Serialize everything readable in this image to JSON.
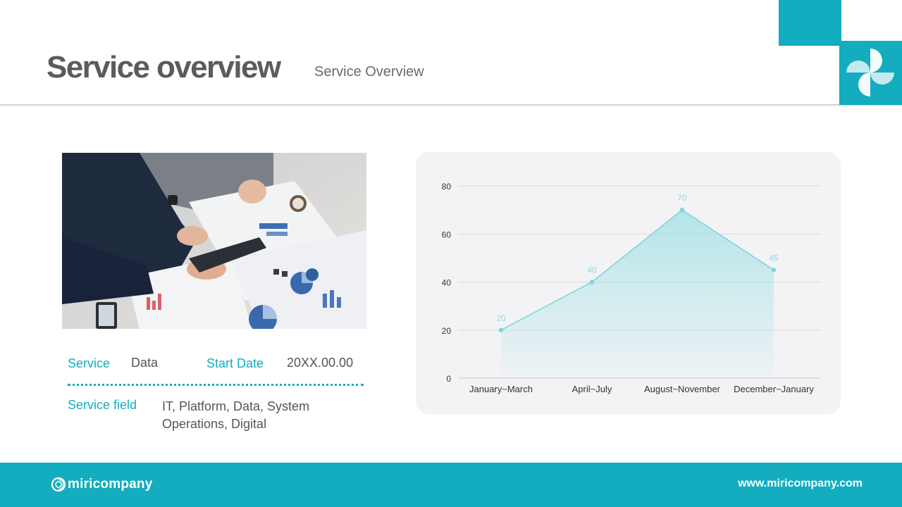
{
  "header": {
    "title": "Service overview",
    "subtitle": "Service Overview"
  },
  "colors": {
    "accent": "#13adbf",
    "chart_line": "#7fd6dd",
    "chart_fill": "#a9e2e6"
  },
  "info": {
    "service_label": "Service",
    "service_value": "Data",
    "start_date_label": "Start Date",
    "start_date_value": "20XX.00.00",
    "service_field_label": "Service field",
    "service_field_value": "IT, Platform, Data, System Operations, Digital"
  },
  "chart_data": {
    "type": "area",
    "categories": [
      "January~March",
      "April~July",
      "August~November",
      "December~January"
    ],
    "series": [
      {
        "values": [
          20,
          40,
          70,
          45
        ]
      }
    ],
    "ylim": [
      0,
      80
    ],
    "yticks": [
      0,
      20,
      40,
      60,
      80
    ],
    "grid": true,
    "data_labels": true
  },
  "footer": {
    "brand": "miricompany",
    "website": "www.miricompany.com"
  }
}
